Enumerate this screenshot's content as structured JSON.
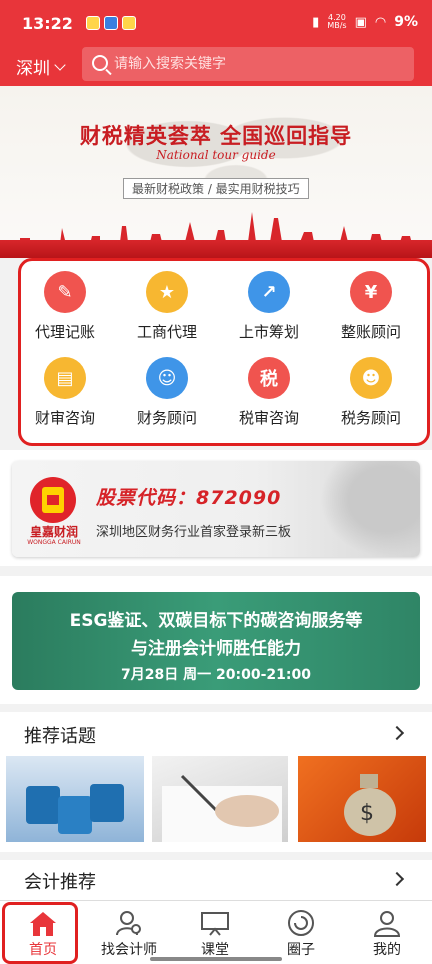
{
  "status_bar": {
    "time": "13:22",
    "net_speed_top": "4.20",
    "net_speed_bottom": "MB/s",
    "battery": "9%"
  },
  "header": {
    "city": "深圳",
    "search_placeholder": "请输入搜索关键字"
  },
  "banner": {
    "title": "财税精英荟萃  全国巡回指导",
    "subtitle_en": "National tour guide",
    "tagline": "最新财税政策 / 最实用财税技巧"
  },
  "services": [
    {
      "label": "代理记账",
      "icon": "document-icon",
      "color": "#f0544f",
      "glyph": "✎"
    },
    {
      "label": "工商代理",
      "icon": "badge-icon",
      "color": "#f7b731",
      "glyph": "★"
    },
    {
      "label": "上市筹划",
      "icon": "chart-icon",
      "color": "#3f95e8",
      "glyph": "↗"
    },
    {
      "label": "整账顾问",
      "icon": "notebook-icon",
      "color": "#f0544f",
      "glyph": "¥"
    },
    {
      "label": "财审咨询",
      "icon": "file-icon",
      "color": "#f7b731",
      "glyph": "▤"
    },
    {
      "label": "财务顾问",
      "icon": "user-icon",
      "color": "#3f95e8",
      "glyph": "☺"
    },
    {
      "label": "税审咨询",
      "icon": "tax-icon",
      "color": "#f0544f",
      "glyph": "税"
    },
    {
      "label": "税务顾问",
      "icon": "advisor-icon",
      "color": "#f7b731",
      "glyph": "☻"
    }
  ],
  "stock_card": {
    "brand": "皇嘉财润",
    "brand_en": "WONGGA CAIRUN",
    "code_label": "股票代码：872090",
    "description": "深圳地区财务行业首家登录新三板"
  },
  "esg_banner": {
    "line1": "ESG鉴证、双碳目标下的碳咨询服务等",
    "line2": "与注册会计师胜任能力",
    "line3": "7月28日  周一  20:00-21:00"
  },
  "topics": {
    "title": "推荐话题"
  },
  "recommend": {
    "title": "会计推荐"
  },
  "bottom_nav": [
    {
      "label": "首页",
      "icon": "home-icon",
      "active": true
    },
    {
      "label": "找会计师",
      "icon": "find-accountant-icon",
      "active": false
    },
    {
      "label": "课堂",
      "icon": "classroom-icon",
      "active": false
    },
    {
      "label": "圈子",
      "icon": "circle-icon",
      "active": false
    },
    {
      "label": "我的",
      "icon": "profile-icon",
      "active": false
    }
  ],
  "colors": {
    "brand_red": "#e8353a",
    "highlight_red": "#e02020",
    "esg_green": "#3a9c78"
  }
}
